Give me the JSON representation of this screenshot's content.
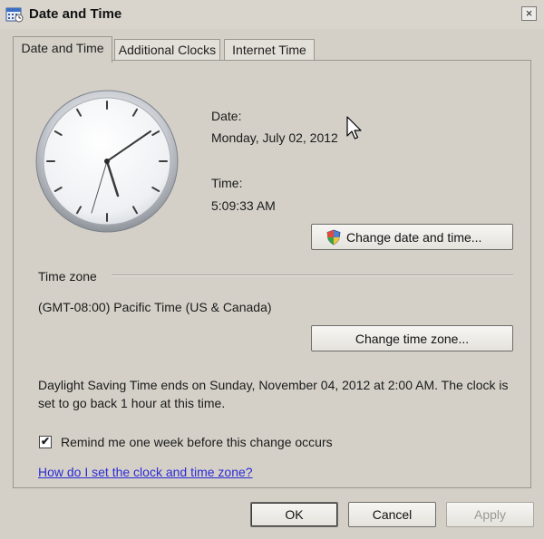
{
  "window": {
    "title": "Date and Time",
    "close_glyph": "×",
    "icon": "calendar-clock-icon"
  },
  "tabs": [
    {
      "label": "Date and Time",
      "active": true
    },
    {
      "label": "Additional Clocks",
      "active": false
    },
    {
      "label": "Internet Time",
      "active": false
    }
  ],
  "date_time": {
    "date_label": "Date:",
    "date_value": "Monday, July 02, 2012",
    "time_label": "Time:",
    "time_value": "5:09:33 AM",
    "change_button": "Change date and time...",
    "shield_icon": "uac-shield-icon"
  },
  "timezone": {
    "section_label": "Time zone",
    "value": "(GMT-08:00) Pacific Time (US & Canada)",
    "change_button": "Change time zone..."
  },
  "dst": {
    "message": "Daylight Saving Time ends on Sunday, November 04, 2012 at 2:00 AM. The clock is set to go back 1 hour at this time.",
    "reminder_label": "Remind me one week before this change occurs",
    "reminder_checked": true,
    "reminder_check_glyph": "✔"
  },
  "help_link": "How do I set the clock and time zone?",
  "footer": {
    "ok": "OK",
    "cancel": "Cancel",
    "apply": "Apply"
  },
  "colors": {
    "background": "#d4d0c8",
    "link": "#2b2bd6"
  }
}
